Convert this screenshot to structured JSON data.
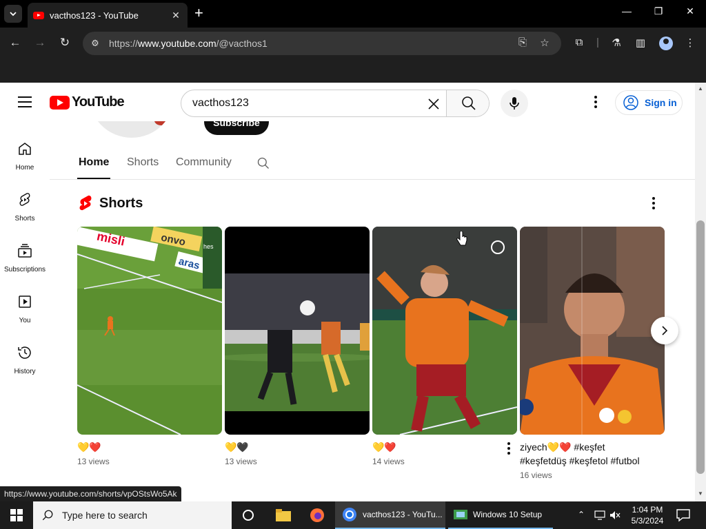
{
  "browser": {
    "tab_title": "vacthos123 - YouTube",
    "url_prefix": "https://",
    "url_domain": "www.youtube.com",
    "url_path": "/@vacthos1",
    "status_url": "https://www.youtube.com/shorts/vpOStsWo5Ak"
  },
  "youtube": {
    "logo_text": "YouTube",
    "search_value": "vacthos123",
    "search_placeholder": "Search",
    "signin_label": "Sign in",
    "sidebar": [
      {
        "label": "Home"
      },
      {
        "label": "Shorts"
      },
      {
        "label": "Subscriptions"
      },
      {
        "label": "You"
      },
      {
        "label": "History"
      }
    ],
    "subscribe_label": "Subscribe",
    "channel_tabs": [
      {
        "label": "Home"
      },
      {
        "label": "Shorts"
      },
      {
        "label": "Community"
      }
    ],
    "active_tab": "Home",
    "shorts_section_title": "Shorts",
    "shorts": [
      {
        "title": "💛❤️",
        "views": "13 views"
      },
      {
        "title": "💛🖤",
        "views": "13 views"
      },
      {
        "title": "💛❤️",
        "views": "14 views"
      },
      {
        "title": "ziyech💛❤️ #keşfet #keşfetdüş #keşfetol #futbol",
        "views": "16 views"
      }
    ],
    "thumb_texts": {
      "misli": "misli",
      "onvo": "onvo",
      "aras": "aras",
      "hes": "hes"
    },
    "colors": {
      "brand_red": "#ff0000",
      "link_blue": "#065fd4",
      "galatasaray_orange": "#e8731e"
    }
  },
  "taskbar": {
    "search_placeholder": "Type here to search",
    "chrome_app_label": "vacthos123 - YouTu...",
    "setup_app_label": "Windows 10 Setup",
    "time": "1:04 PM",
    "date": "5/3/2024"
  }
}
